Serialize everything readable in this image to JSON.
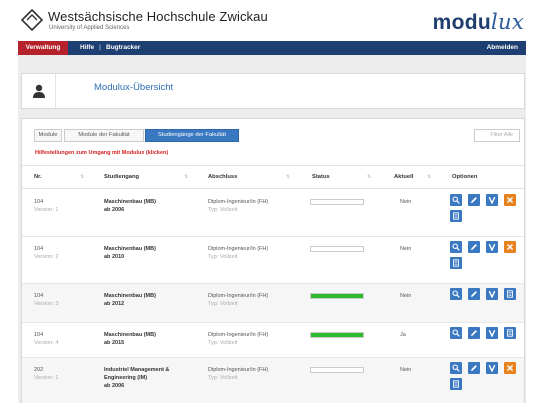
{
  "header": {
    "university_name": "Westsächsische Hochschule Zwickau",
    "university_subtitle": "University of Applied Sciences",
    "brand_main": "modu",
    "brand_script": "lux"
  },
  "nav": {
    "active_item": "Verwaltung",
    "items": [
      "Hilfe",
      "|",
      "Bugtracker"
    ],
    "logout": "Abmelden"
  },
  "overview": {
    "title": "Modulux-Übersicht"
  },
  "tabs": [
    "Module",
    "Module der Fakultät",
    "Studiengänge der Fakultät"
  ],
  "active_tab_index": 2,
  "filter_placeholder": "Filter Alle",
  "hint": "Hilfestellungen zum Umgang mit Modulux (klicken)",
  "table": {
    "columns": [
      "Nr.",
      "Studiengang",
      "Abschluss",
      "Status",
      "Aktuell",
      "Optionen"
    ],
    "rows": [
      {
        "nr": "104",
        "version": "Version: 1",
        "program": "Maschinenbau (MB)",
        "since": "ab 2006",
        "program_line3": "",
        "degree": "Diplom-Ingenieur/in (FH)",
        "type": "Typ: Vollzeit",
        "status_progress": 0.0,
        "current": "Nein"
      },
      {
        "nr": "104",
        "version": "Version: 2",
        "program": "Maschinenbau (MB)",
        "since": "ab 2010",
        "program_line3": "",
        "degree": "Diplom-Ingenieur/in (FH)",
        "type": "Typ: Vollzeit",
        "status_progress": 0.0,
        "current": "Nein"
      },
      {
        "nr": "104",
        "version": "Version: 3",
        "program": "Maschinenbau (MB)",
        "since": "ab 2012",
        "program_line3": "",
        "degree": "Diplom-Ingenieur/in (FH)",
        "type": "Typ: Vollzeit",
        "status_progress": 1.0,
        "current": "Nein"
      },
      {
        "nr": "104",
        "version": "Version: 4",
        "program": "Maschinenbau (MB)",
        "since": "ab 2015",
        "program_line3": "",
        "degree": "Diplom-Ingenieur/in (FH)",
        "type": "Typ: Vollzeit",
        "status_progress": 1.0,
        "current": "Ja"
      },
      {
        "nr": "202",
        "version": "Version: 1",
        "program": "Industriel Management &",
        "since": "Engineering (IM)",
        "program_line3": "ab 2006",
        "degree": "Diplom-Ingenieur/in (FH)",
        "type": "Typ: Vollzeit",
        "status_progress": 0.0,
        "current": "Nein"
      }
    ]
  },
  "colors": {
    "nav": "#1d3f72",
    "nav_active": "#b5222b",
    "accent": "#3a78c2",
    "danger_button": "#e8821e",
    "status_ok": "#2dbb2d",
    "hint": "#d41e1e"
  },
  "icons": {
    "view": "magnifier-icon",
    "edit": "pencil-icon",
    "version": "v-icon",
    "delete": "close-icon",
    "copy": "document-icon",
    "profile": "user-icon",
    "logo": "diamond-logo-icon",
    "sort": "sort-icon"
  }
}
